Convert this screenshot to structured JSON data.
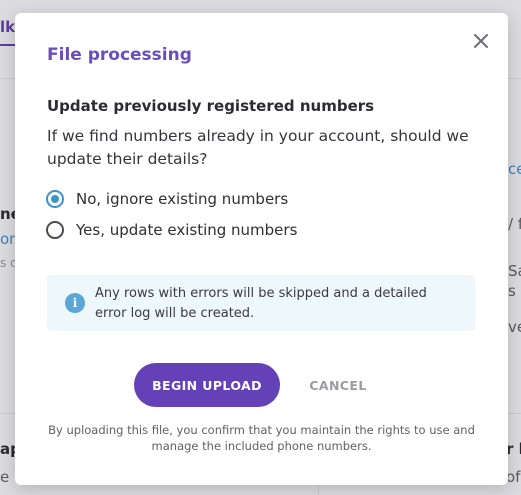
{
  "background": {
    "fragments": [
      "lk",
      "ne",
      "om",
      "s o",
      "ce",
      "/ f",
      "Sat",
      "s u",
      "ve",
      "ap",
      "e",
      "r l",
      "of"
    ]
  },
  "modal": {
    "title": "File processing",
    "close_icon": "close-icon",
    "section_heading": "Update previously registered numbers",
    "question": "If we find numbers already in your account, should we update their details?",
    "options": [
      {
        "label": "No, ignore existing numbers",
        "checked": true
      },
      {
        "label": "Yes, update existing numbers",
        "checked": false
      }
    ],
    "info": {
      "icon": "info-icon",
      "text": "Any rows with errors will be skipped and a detailed error log will be created."
    },
    "begin_upload_label": "BEGIN UPLOAD",
    "cancel_label": "CANCEL",
    "disclaimer": "By uploading this file, you confirm that you maintain the rights to use and manage the included phone numbers."
  },
  "colors": {
    "accent": "#6441b6",
    "title": "#6a4dbf",
    "radio_checked": "#3b93c8",
    "info_bg": "#eef7fc"
  }
}
